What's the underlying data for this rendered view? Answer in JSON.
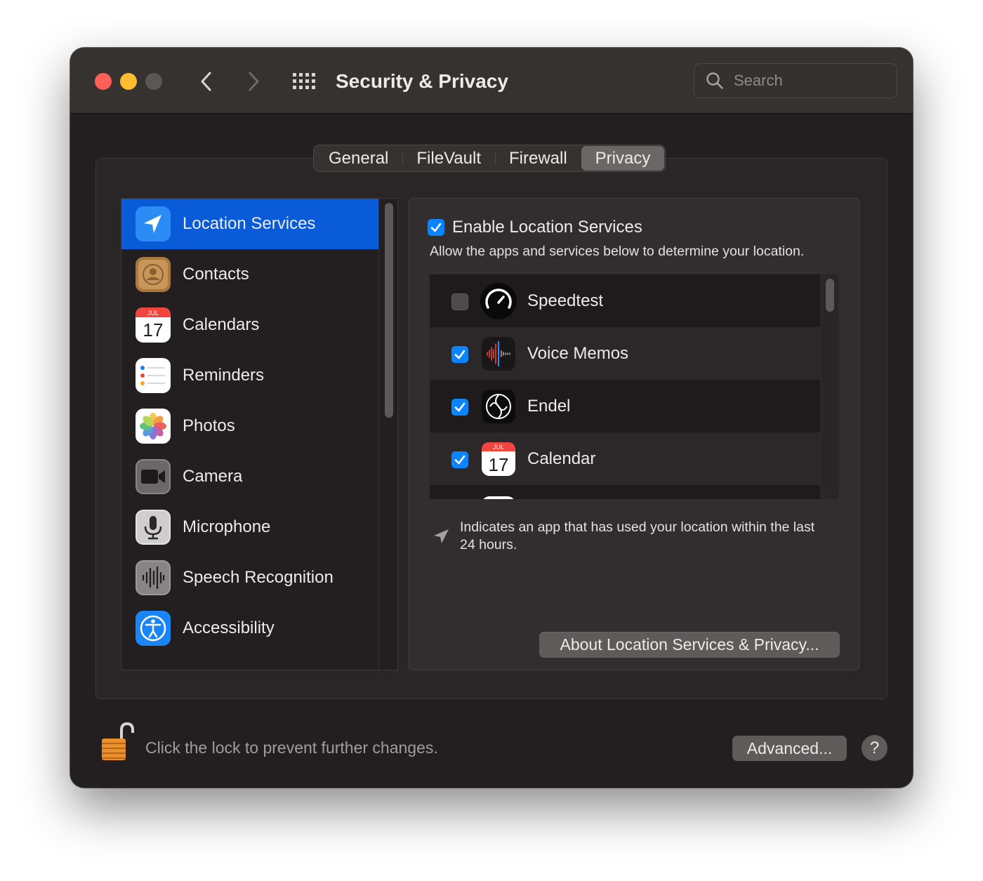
{
  "window": {
    "title": "Security & Privacy",
    "search_placeholder": "Search"
  },
  "tabs": [
    {
      "label": "General"
    },
    {
      "label": "FileVault"
    },
    {
      "label": "Firewall"
    },
    {
      "label": "Privacy",
      "active": true
    }
  ],
  "sidebar": {
    "items": [
      {
        "label": "Location Services",
        "icon": "location-arrow-icon",
        "selected": true
      },
      {
        "label": "Contacts",
        "icon": "contacts-icon"
      },
      {
        "label": "Calendars",
        "icon": "calendar-icon",
        "icon_text_month": "JUL",
        "icon_text_day": "17"
      },
      {
        "label": "Reminders",
        "icon": "reminders-icon"
      },
      {
        "label": "Photos",
        "icon": "photos-icon"
      },
      {
        "label": "Camera",
        "icon": "camera-icon"
      },
      {
        "label": "Microphone",
        "icon": "microphone-icon"
      },
      {
        "label": "Speech Recognition",
        "icon": "waveform-icon"
      },
      {
        "label": "Accessibility",
        "icon": "accessibility-icon"
      }
    ]
  },
  "panel": {
    "enable_label": "Enable Location Services",
    "enable_checked": true,
    "description": "Allow the apps and services below to determine your location.",
    "apps": [
      {
        "label": "Speedtest",
        "checked": false,
        "icon": "speedtest-icon"
      },
      {
        "label": "Voice Memos",
        "checked": true,
        "icon": "voice-memos-icon"
      },
      {
        "label": "Endel",
        "checked": true,
        "icon": "endel-icon"
      },
      {
        "label": "Calendar",
        "checked": true,
        "icon": "calendar-icon",
        "icon_text_month": "JUL",
        "icon_text_day": "17"
      }
    ],
    "legend_text": "Indicates an app that has used your location within the last 24 hours.",
    "about_button": "About Location Services & Privacy..."
  },
  "footer": {
    "lock_text": "Click the lock to prevent further changes.",
    "advanced_button": "Advanced...",
    "help_button": "?"
  },
  "colors": {
    "accent": "#0a84ff",
    "selection": "#0a5bd7",
    "window_bg": "#231f20",
    "titlebar_bg": "#36322f"
  }
}
